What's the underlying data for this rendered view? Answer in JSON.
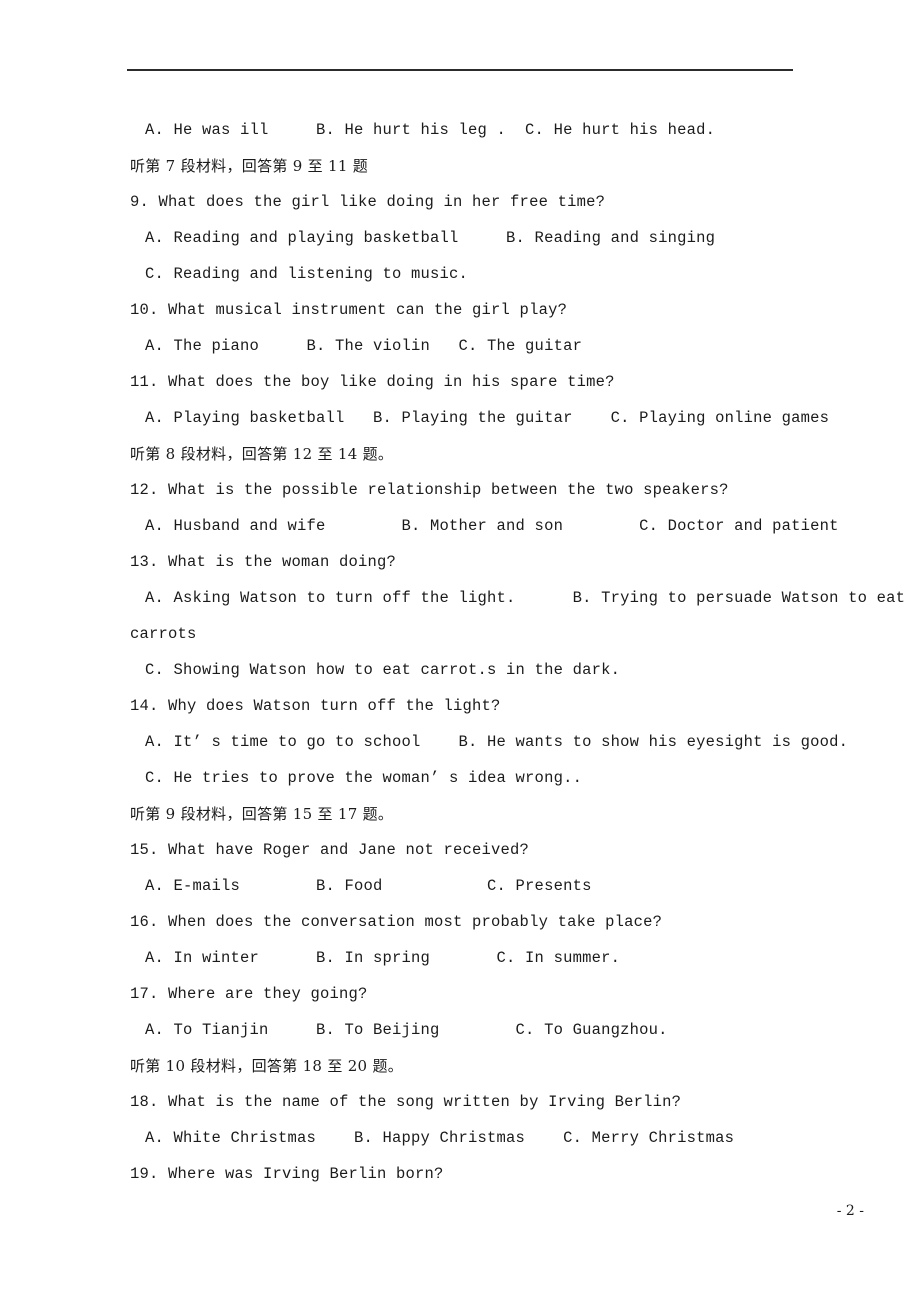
{
  "document": {
    "page_number_label": "- 2 -",
    "header_rule": true
  },
  "lines": [
    {
      "kind": "opt",
      "text": "A. He was ill     B. He hurt his leg .  C. He hurt his head."
    },
    {
      "kind": "cn",
      "text": "听第 7 段材料，回答第 9 至 11 题"
    },
    {
      "kind": "q",
      "text": "9. What does the girl like doing in her free time?"
    },
    {
      "kind": "opt",
      "text": "A. Reading and playing basketball     B. Reading and singing"
    },
    {
      "kind": "opt",
      "text": "C. Reading and listening to music."
    },
    {
      "kind": "q",
      "text": "10. What musical instrument can the girl play?"
    },
    {
      "kind": "opt",
      "text": "A. The piano     B. The violin   C. The guitar"
    },
    {
      "kind": "q",
      "text": "11. What does the boy like doing in his spare time?"
    },
    {
      "kind": "opt",
      "text": "A. Playing basketball   B. Playing the guitar    C. Playing online games"
    },
    {
      "kind": "cn",
      "text": "听第 8 段材料，回答第 12 至 14 题。"
    },
    {
      "kind": "q",
      "text": "12. What is the possible relationship between the two speakers?"
    },
    {
      "kind": "opt",
      "text": "A. Husband and wife        B. Mother and son        C. Doctor and patient"
    },
    {
      "kind": "q",
      "text": "13. What is the woman doing?"
    },
    {
      "kind": "opt",
      "text": "A. Asking Watson to turn off the light.      B. Trying to persuade Watson to eat"
    },
    {
      "kind": "cont",
      "text": "carrots"
    },
    {
      "kind": "opt",
      "text": "C. Showing Watson how to eat carrot.s in the dark."
    },
    {
      "kind": "q",
      "text": "14. Why does Watson turn off the light?"
    },
    {
      "kind": "opt",
      "text": "A. It’ s time to go to school    B. He wants to show his eyesight is good."
    },
    {
      "kind": "opt",
      "text": "C. He tries to prove the woman’ s idea wrong.."
    },
    {
      "kind": "cn",
      "text": "听第 9 段材料，回答第 15 至 17 题。"
    },
    {
      "kind": "q",
      "text": "15. What have Roger and Jane not received?"
    },
    {
      "kind": "opt",
      "text": "A. E-mails        B. Food           C. Presents"
    },
    {
      "kind": "q",
      "text": "16. When does the conversation most probably take place?"
    },
    {
      "kind": "opt",
      "text": "A. In winter      B. In spring       C. In summer."
    },
    {
      "kind": "q",
      "text": "17. Where are they going?"
    },
    {
      "kind": "opt",
      "text": "A. To Tianjin     B. To Beijing        C. To Guangzhou."
    },
    {
      "kind": "cn",
      "text": "听第 10 段材料，回答第 18 至 20 题。"
    },
    {
      "kind": "q",
      "text": "18. What is the name of the song written by Irving Berlin?"
    },
    {
      "kind": "opt",
      "text": "A. White Christmas    B. Happy Christmas    C. Merry Christmas"
    },
    {
      "kind": "q",
      "text": "19. Where was Irving Berlin born?"
    }
  ]
}
